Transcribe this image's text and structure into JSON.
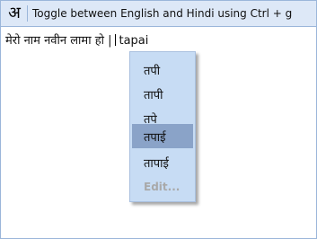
{
  "toolbar": {
    "toggle_glyph": "अ",
    "hint": "Toggle between English and Hindi using Ctrl + g"
  },
  "editor": {
    "committed_text": "मेरो नाम नवीन लामा हो |",
    "pending_word": "tapai"
  },
  "suggestion_menu": {
    "items": [
      "तपी",
      "तापी",
      "तपे",
      "तपाई",
      "तापाई"
    ],
    "selected": "तपाई",
    "edit_label": "Edit..."
  },
  "colors": {
    "toolbar_bg": "#dde8f7",
    "border": "#9bb6da",
    "menu_bg": "#c7dcf4",
    "menu_selected_bg": "#8aa3c8",
    "disabled_text": "#a9a9a9"
  }
}
